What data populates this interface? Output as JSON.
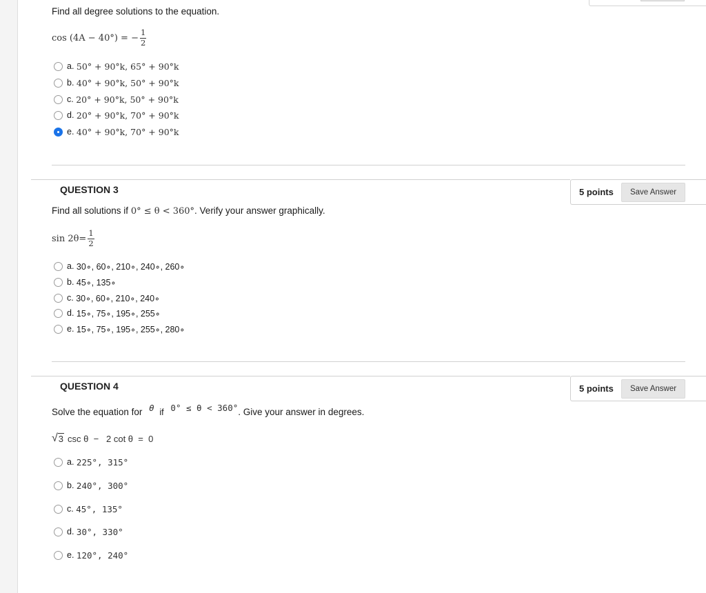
{
  "q2": {
    "prompt": "Find all degree solutions to the equation.",
    "equation_lhs": "cos (4A − 40°) = −",
    "equation_num": "1",
    "equation_den": "2",
    "options": [
      {
        "letter": "a.",
        "value": "50° + 90°k, 65° + 90°k",
        "selected": false
      },
      {
        "letter": "b.",
        "value": "40° + 90°k, 50° + 90°k",
        "selected": false
      },
      {
        "letter": "c.",
        "value": "20° + 90°k, 50° + 90°k",
        "selected": false
      },
      {
        "letter": "d.",
        "value": "20° + 90°k, 70° + 90°k",
        "selected": false
      },
      {
        "letter": "e.",
        "value": "40° + 90°k, 70° + 90°k",
        "selected": true
      }
    ]
  },
  "q3": {
    "title": "QUESTION 3",
    "points": "5 points",
    "save_label": "Save Answer",
    "prompt_prefix": "Find all solutions if ",
    "prompt_condition": "0° ≤ θ < 360°",
    "prompt_suffix": ". Verify your answer graphically.",
    "equation_lhs": "sin 2θ= ",
    "equation_num": "1",
    "equation_den": "2",
    "options": [
      {
        "letter": "a.",
        "value": "30∘, 60∘, 210∘, 240∘, 260∘",
        "selected": false
      },
      {
        "letter": "b.",
        "value": "45∘, 135∘",
        "selected": false
      },
      {
        "letter": "c.",
        "value": "30∘, 60∘, 210∘, 240∘",
        "selected": false
      },
      {
        "letter": "d.",
        "value": "15∘, 75∘, 195∘, 255∘",
        "selected": false
      },
      {
        "letter": "e.",
        "value": "15∘, 75∘, 195∘, 255∘, 280∘",
        "selected": false
      }
    ]
  },
  "q4": {
    "title": "QUESTION 4",
    "points": "5 points",
    "save_label": "Save Answer",
    "prompt_prefix": "Solve the equation for",
    "prompt_theta": "θ",
    "prompt_if": "if",
    "prompt_condition": "0° ≤ θ < 360°",
    "prompt_suffix": ". Give your answer in degrees.",
    "equation_radicand": "3",
    "equation_rest": "csc θ  −   2 cot θ  =  0",
    "options": [
      {
        "letter": "a.",
        "value": "225°, 315°",
        "selected": false
      },
      {
        "letter": "b.",
        "value": "240°, 300°",
        "selected": false
      },
      {
        "letter": "c.",
        "value": "45°, 135°",
        "selected": false
      },
      {
        "letter": "d.",
        "value": "30°, 330°",
        "selected": false
      },
      {
        "letter": "e.",
        "value": "120°, 240°",
        "selected": false
      }
    ]
  }
}
